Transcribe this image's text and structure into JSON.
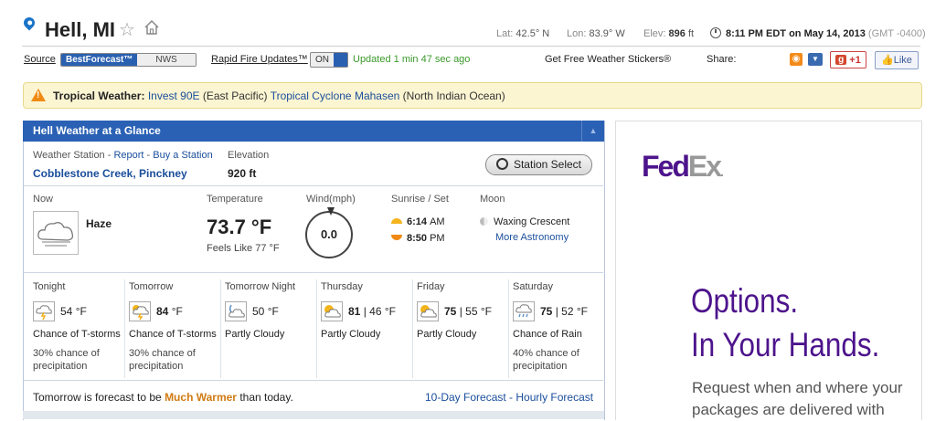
{
  "header": {
    "city": "Hell, MI",
    "lat_label": "Lat:",
    "lat": "42.5° N",
    "lon_label": "Lon:",
    "lon": "83.9° W",
    "elev_label": "Elev:",
    "elev": "896",
    "elev_unit": "ft",
    "datetime": "8:11 PM EDT on May 14, 2013",
    "gmt": "(GMT -0400)"
  },
  "toolbar": {
    "source_label": "Source",
    "source_on": "BestForecast™",
    "source_off": "NWS",
    "rapid_label": "Rapid Fire Updates™",
    "rapid_state": "ON",
    "updated": "Updated 1 min 47 sec ago",
    "stickers": "Get Free Weather Stickers®",
    "share": "Share:",
    "gplus": "+1",
    "like": "Like"
  },
  "alert": {
    "prefix": "Tropical Weather:",
    "link1": "Invest 90E",
    "text1": "(East Pacific)",
    "link2": "Tropical Cyclone Mahasen",
    "text2": "(North Indian Ocean)"
  },
  "glance": {
    "title": "Hell Weather at a Glance",
    "station_label": "Weather Station -",
    "report": "Report",
    "buy": "Buy a Station",
    "station_name": "Cobblestone Creek, Pinckney",
    "elevation_label": "Elevation",
    "elevation": "920 ft",
    "station_select": "Station Select",
    "now_label": "Now",
    "condition": "Haze",
    "temp_label": "Temperature",
    "temp": "73.7 °F",
    "feels_prefix": "Feels Like",
    "feels": "77",
    "feels_unit": "°F",
    "wind_label": "Wind(mph)",
    "wind": "0.0",
    "sun_label": "Sunrise / Set",
    "sunrise": "6:14",
    "sunrise_ampm": "AM",
    "sunset": "8:50",
    "sunset_ampm": "PM",
    "moon_label": "Moon",
    "moon_phase": "Waxing Crescent",
    "astronomy": "More Astronomy"
  },
  "forecast": [
    {
      "name": "Tonight",
      "temp": "54",
      "unit": "°F",
      "desc": "Chance of T-storms",
      "chance": "30% chance of precipitation"
    },
    {
      "name": "Tomorrow",
      "temp": "84",
      "unit": "°F",
      "desc": "Chance of T-storms",
      "chance": "30% chance of precipitation"
    },
    {
      "name": "Tomorrow Night",
      "temp": "50",
      "unit": "°F",
      "desc": "Partly Cloudy",
      "chance": ""
    },
    {
      "name": "Thursday",
      "temp": "81",
      "low": "46 °F",
      "desc": "Partly Cloudy",
      "chance": ""
    },
    {
      "name": "Friday",
      "temp": "75",
      "low": "55 °F",
      "desc": "Partly Cloudy",
      "chance": ""
    },
    {
      "name": "Saturday",
      "temp": "75",
      "low": "52 °F",
      "desc": "Chance of Rain",
      "chance": "40% chance of precipitation"
    }
  ],
  "summary": {
    "prefix": "Tomorrow is forecast to be",
    "highlight": "Much Warmer",
    "suffix": "than today.",
    "tenday": "10-Day Forecast",
    "dash": "-",
    "hourly": "Hourly Forecast"
  },
  "ad": {
    "logo_fe": "Fed",
    "logo_ex": "Ex",
    "logo_dot": ".",
    "headline1": "Options.",
    "headline2": "In Your Hands.",
    "body1": "Request when and where your",
    "body2": "packages are delivered with"
  },
  "colors": {
    "brand": "#2a61b4",
    "fedex_purple": "#4d148c",
    "warm": "#d07a12",
    "updated_green": "#3a9a2a"
  }
}
